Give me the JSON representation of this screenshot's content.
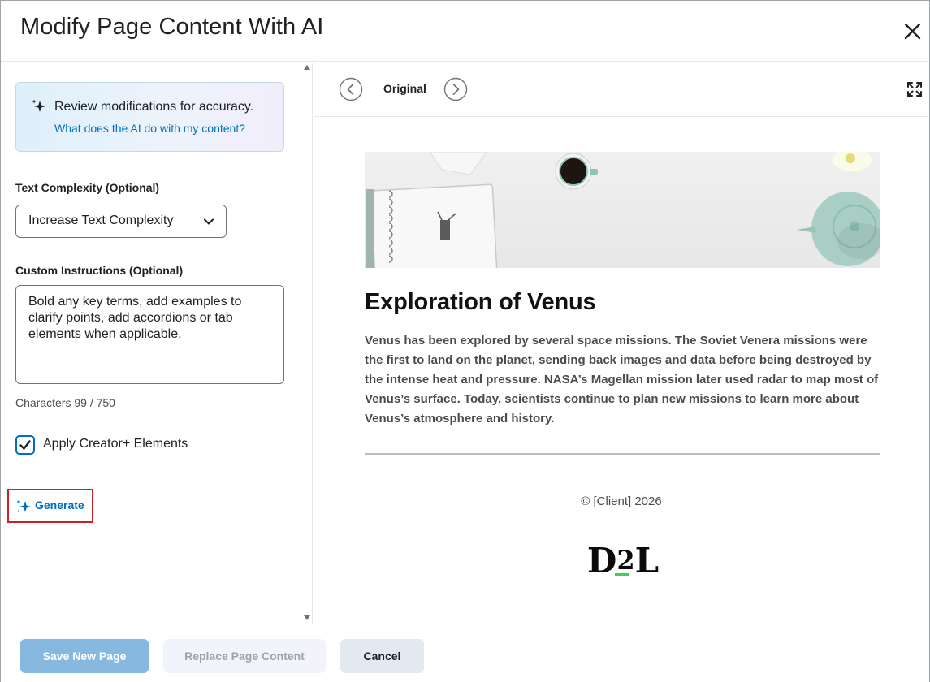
{
  "dialog": {
    "title": "Modify Page Content With AI",
    "close_icon": "close-icon"
  },
  "left_panel": {
    "info": {
      "icon": "sparkle-icon",
      "message": "Review modifications for accuracy.",
      "link": "What does the AI do with my content?"
    },
    "text_complexity": {
      "label": "Text Complexity (Optional)",
      "selected": "Increase Text Complexity"
    },
    "custom_instructions": {
      "label": "Custom Instructions (Optional)",
      "value": "Bold any key terms, add examples to clarify points, add accordions or tab elements when applicable.",
      "char_count": "Characters 99 / 750"
    },
    "apply_creator": {
      "label": "Apply Creator+ Elements",
      "checked": true
    },
    "generate_label": "Generate"
  },
  "preview": {
    "version_label": "Original",
    "title": "Exploration of Venus",
    "body": "Venus has been explored by several space missions. The Soviet Venera missions were the first to land on the planet, sending back images and data before being destroyed by the intense heat and pressure. NASA’s Magellan mission later used radar to map most of Venus’s surface. Today, scientists continue to plan new missions to learn more about Venus’s atmosphere and history.",
    "copyright": "© [Client] 2026",
    "logo_text": "D2L"
  },
  "footer": {
    "save_label": "Save New Page",
    "replace_label": "Replace Page Content",
    "cancel_label": "Cancel"
  },
  "colors": {
    "link": "#006fbf",
    "primary_disabled": "#87b8df",
    "highlight_border": "#cd2026",
    "logo_accent": "#3dd14c"
  }
}
